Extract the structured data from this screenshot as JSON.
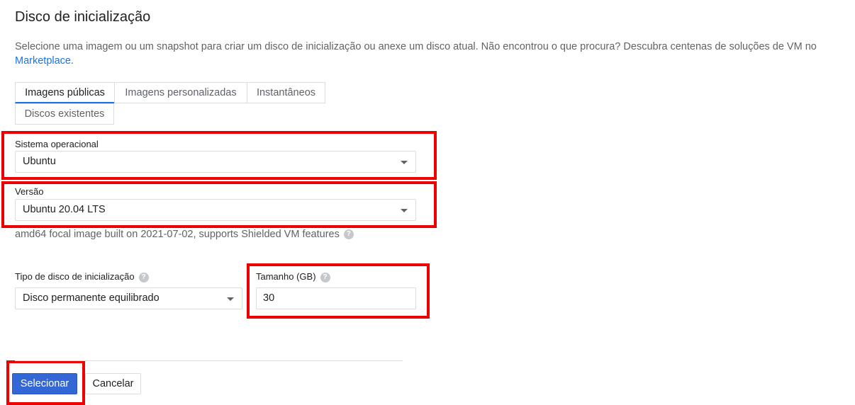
{
  "dialog": {
    "title": "Disco de inicialização",
    "description_text": "Selecione uma imagem ou um snapshot para criar um disco de inicialização ou anexe um disco atual. Não encontrou o que procura? Descubra centenas de soluções de VM no ",
    "marketplace_link": "Marketplace",
    "description_end": "."
  },
  "tabs": [
    {
      "label": "Imagens públicas",
      "active": true
    },
    {
      "label": "Imagens personalizadas",
      "active": false
    },
    {
      "label": "Instantâneos",
      "active": false
    },
    {
      "label": "Discos existentes",
      "active": false
    }
  ],
  "os_field": {
    "label": "Sistema operacional",
    "value": "Ubuntu"
  },
  "version_field": {
    "label": "Versão",
    "value": "Ubuntu 20.04 LTS"
  },
  "image_hint": "amd64 focal image built on 2021-07-02, supports Shielded VM features",
  "disk_type_field": {
    "label": "Tipo de disco de inicialização",
    "value": "Disco permanente equilibrado"
  },
  "size_field": {
    "label": "Tamanho (GB)",
    "value": "30"
  },
  "help_glyph": "?",
  "buttons": {
    "select": "Selecionar",
    "cancel": "Cancelar"
  },
  "colors": {
    "highlight": "#ee0000",
    "primary": "#3367d6",
    "link": "#1a73e8"
  }
}
